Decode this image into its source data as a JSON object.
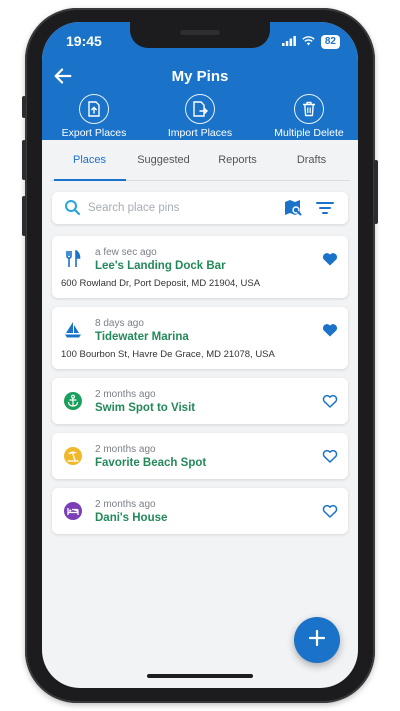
{
  "status_bar": {
    "time": "19:45",
    "battery": "82"
  },
  "header": {
    "title": "My Pins"
  },
  "actions": [
    {
      "label": "Export Places",
      "icon": "export-file-icon"
    },
    {
      "label": "Import Places",
      "icon": "import-file-icon"
    },
    {
      "label": "Multiple Delete",
      "icon": "trash-icon"
    }
  ],
  "tabs": [
    {
      "label": "Places",
      "active": true
    },
    {
      "label": "Suggested",
      "active": false
    },
    {
      "label": "Reports",
      "active": false
    },
    {
      "label": "Drafts",
      "active": false
    }
  ],
  "search": {
    "placeholder": "Search place pins"
  },
  "pins": [
    {
      "time": "a few sec ago",
      "name": "Lee's Landing Dock Bar",
      "address": "600 Rowland Dr, Port Deposit, MD 21904, USA",
      "icon": "restaurant-icon",
      "favorite": true
    },
    {
      "time": "8 days ago",
      "name": "Tidewater Marina",
      "address": "100 Bourbon St, Havre De Grace, MD 21078, USA",
      "icon": "sailboat-icon",
      "favorite": true
    },
    {
      "time": "2 months ago",
      "name": "Swim Spot to Visit",
      "address": "",
      "icon": "anchor-icon",
      "favorite": false
    },
    {
      "time": "2 months ago",
      "name": "Favorite Beach Spot",
      "address": "",
      "icon": "beach-icon",
      "favorite": false
    },
    {
      "time": "2 months ago",
      "name": "Dani's House",
      "address": "",
      "icon": "bed-icon",
      "favorite": false
    }
  ],
  "colors": {
    "primary": "#1a73c8",
    "name_green": "#23895a",
    "anchor_green": "#1aa05c",
    "beach_yellow": "#f0b92c",
    "bed_purple": "#7b3fb8"
  }
}
